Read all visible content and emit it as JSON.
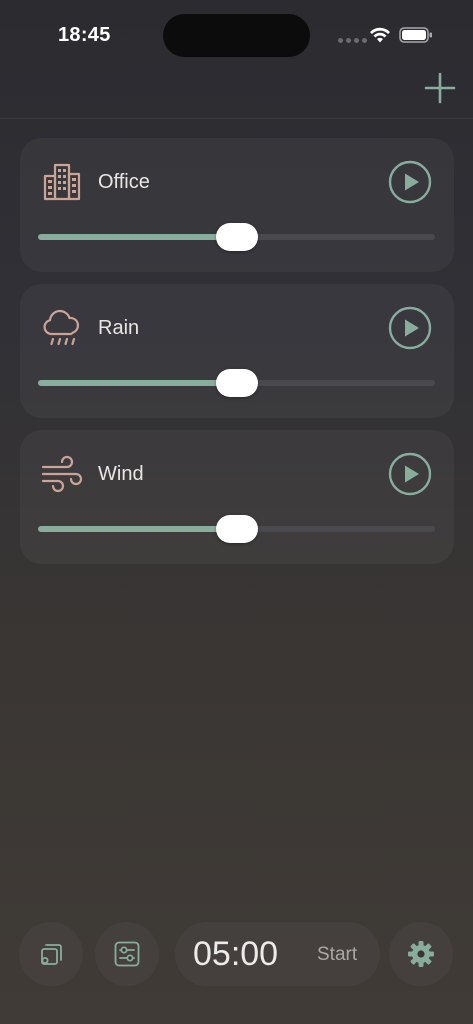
{
  "status_bar": {
    "time": "18:45"
  },
  "colors": {
    "accent": "#88ad9d",
    "icon_tint": "#c9a497",
    "track": "#4a4a4e",
    "thumb": "#ffffff"
  },
  "sounds": [
    {
      "label": "Office",
      "icon": "office-building-icon",
      "volume": 0.5
    },
    {
      "label": "Rain",
      "icon": "rain-cloud-icon",
      "volume": 0.5
    },
    {
      "label": "Wind",
      "icon": "wind-icon",
      "volume": 0.5
    }
  ],
  "bottom_bar": {
    "timer": "05:00",
    "start_label": "Start"
  }
}
